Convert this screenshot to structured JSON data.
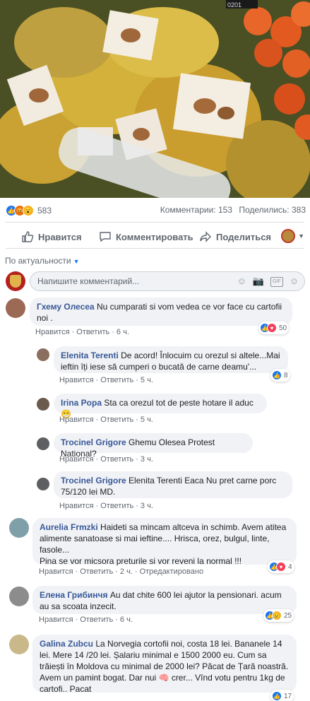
{
  "post": {
    "reactions_count": "583",
    "comments_label": "Комментарии: 153",
    "shares_label": "Поделились: 383",
    "photo_corner_text": "0201"
  },
  "actions": {
    "like": "Нравится",
    "comment": "Комментировать",
    "share": "Поделиться"
  },
  "sort_label": "По актуальности",
  "comment_input": {
    "placeholder": "Напишите комментарий..."
  },
  "meta_labels": {
    "like": "Нравится",
    "reply": "Ответить",
    "edited": "Отредактировано"
  },
  "comments": [
    {
      "name": "Гхему Олесеа",
      "text": "Nu cumparati si vom vedea ce vor face cu cartofii noi .",
      "time": "6 ч.",
      "reactions": "50"
    },
    {
      "name": "Elenita Terenti",
      "text": "De acord! Înlocuim cu orezul si altele...Mai ieftin îți iese să cumperi o bucată de carne deamu'...",
      "time": "5 ч.",
      "reactions": "8"
    },
    {
      "name": "Irina Popa",
      "text": "Sta ca orezul tot de peste hotare il aduc 😁",
      "time": "5 ч."
    },
    {
      "name": "Trocinel Grigore",
      "text": "Ghemu Olesea Protest National?",
      "time": "3 ч."
    },
    {
      "name": "Trocinel Grigore",
      "text": "Elenita Terenti Eaca Nu pret carne porc 75/120 lei MD.",
      "time": "3 ч."
    },
    {
      "name": "Aurelia Frmzki",
      "text": "Haideti sa mincam altceva in schimb. Avem atitea alimente sanatoase si mai ieftine.... Hrisca, orez, bulgul, linte, fasole...",
      "text2": "Pina se vor micsora preturile si vor reveni la normal !!!",
      "time": "2 ч.",
      "reactions": "4"
    },
    {
      "name": "Елена Грибинчя",
      "text": "Au dat chite 600 lei ajutor la pensionari. acum au sa scoata inzecit.",
      "time": "6 ч.",
      "reactions": "25"
    },
    {
      "name": "Galina Zubcu",
      "text": "La Norvegia cortofii noi, costa 18 lei. Bananele 14 lei. Mere 14 /20 lei. Șalariu minimal e 1500 2000 eu. Cum sa trăiești în Moldova cu minimal de 2000 lei? Păcat de Țară noastră. Avem un pamint bogat. Dar nui 🧠 crer... Vînd votu pentru 1kg de cartofi.. Pacat",
      "reactions": "17"
    }
  ]
}
